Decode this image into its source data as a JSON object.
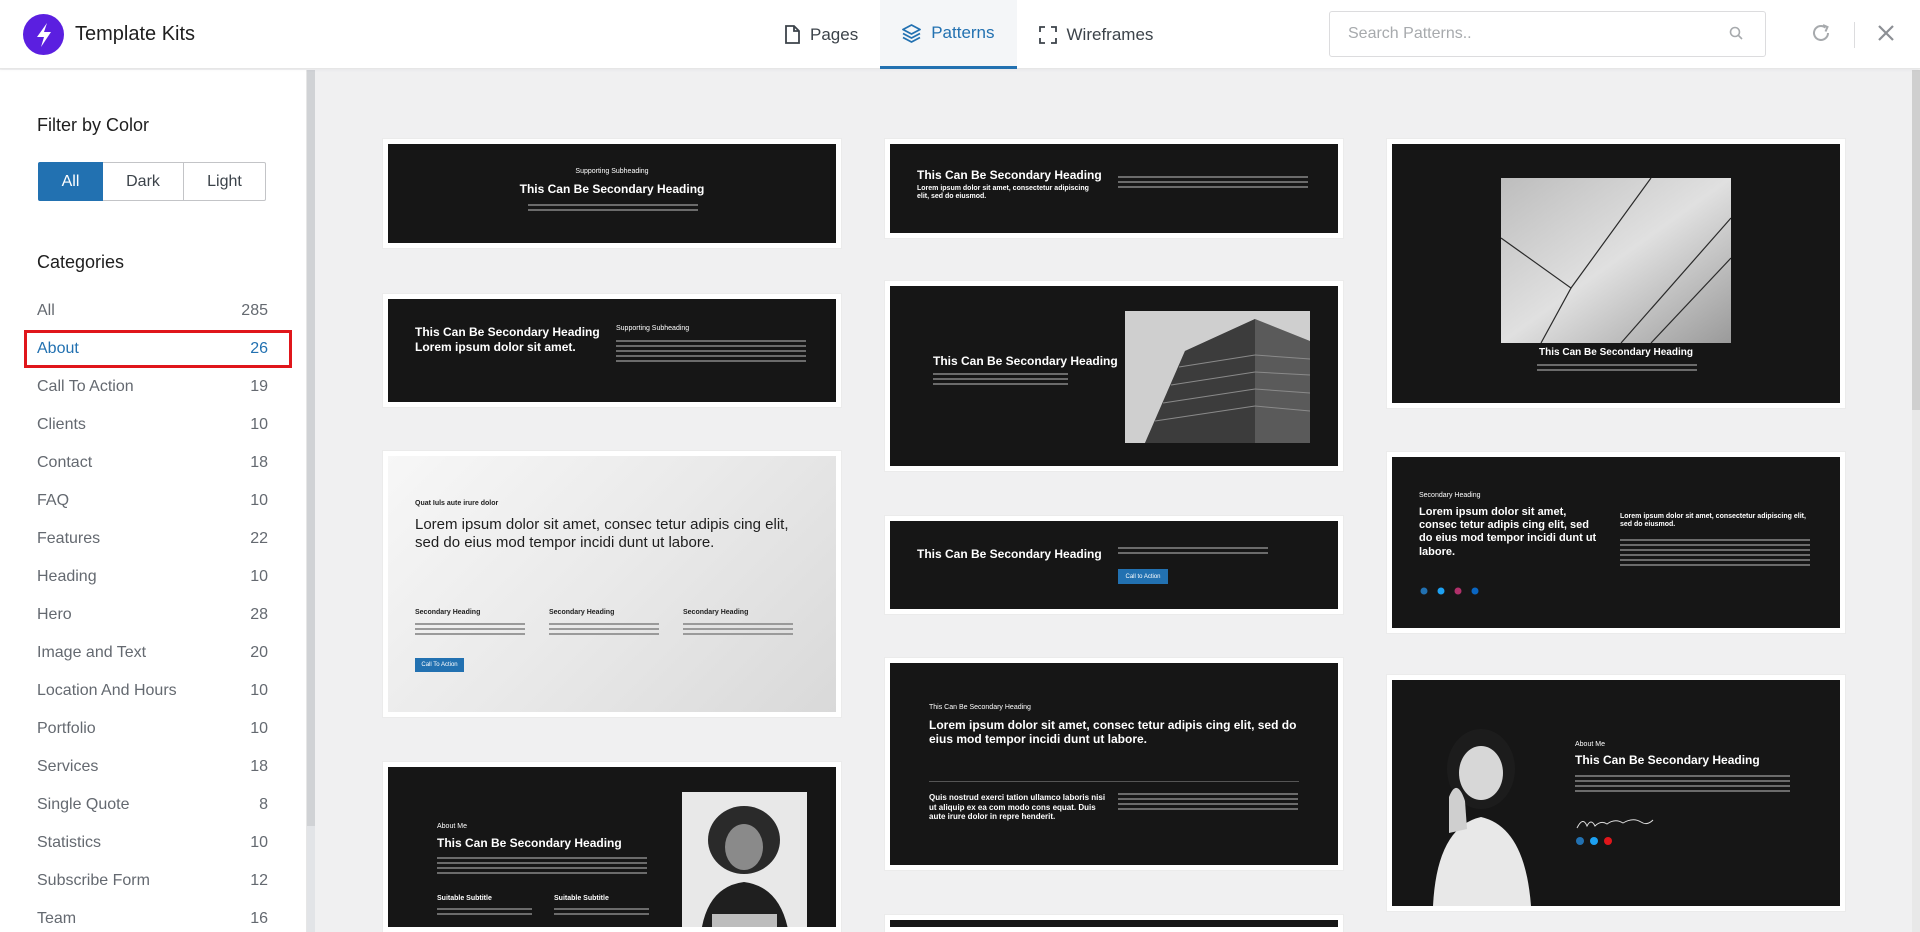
{
  "header": {
    "app_title": "Template Kits",
    "tabs": [
      {
        "label": "Pages",
        "icon": "page-icon",
        "active": false
      },
      {
        "label": "Patterns",
        "icon": "layers-icon",
        "active": true
      },
      {
        "label": "Wireframes",
        "icon": "frame-icon",
        "active": false
      }
    ],
    "search_placeholder": "Search Patterns.."
  },
  "sidebar": {
    "filter_title": "Filter by Color",
    "color_filters": [
      "All",
      "Dark",
      "Light"
    ],
    "selected_color_filter": "All",
    "categories_title": "Categories",
    "categories": [
      {
        "label": "All",
        "count": "285"
      },
      {
        "label": "About",
        "count": "26",
        "active": true
      },
      {
        "label": "Call To Action",
        "count": "19"
      },
      {
        "label": "Clients",
        "count": "10"
      },
      {
        "label": "Contact",
        "count": "18"
      },
      {
        "label": "FAQ",
        "count": "10"
      },
      {
        "label": "Features",
        "count": "22"
      },
      {
        "label": "Heading",
        "count": "10"
      },
      {
        "label": "Hero",
        "count": "28"
      },
      {
        "label": "Image and Text",
        "count": "20"
      },
      {
        "label": "Location And Hours",
        "count": "10"
      },
      {
        "label": "Portfolio",
        "count": "10"
      },
      {
        "label": "Services",
        "count": "18"
      },
      {
        "label": "Single Quote",
        "count": "8"
      },
      {
        "label": "Statistics",
        "count": "10"
      },
      {
        "label": "Subscribe Form",
        "count": "12"
      },
      {
        "label": "Team",
        "count": "16"
      }
    ]
  },
  "patterns": {
    "p1": {
      "sub": "Supporting Subheading",
      "heading": "This Can Be Secondary Heading"
    },
    "p2": {
      "heading": "This Can Be Secondary Heading",
      "sub": "Lorem ipsum dolor sit amet, consectetur adipiscing elit, sed do eiusmod."
    },
    "p3": {
      "heading": "This Can Be Secondary Heading"
    },
    "p4": {
      "heading1": "This Can Be Secondary Heading",
      "heading2": "Lorem ipsum dolor sit amet.",
      "sub": "Supporting Subheading"
    },
    "p5": {
      "heading": "This Can Be Secondary Heading"
    },
    "p6": {
      "sub": "Quat Iuls aute irure dolor",
      "heading": "Lorem ipsum dolor sit amet, consec tetur adipis cing elit, sed do eius mod tempor incidi dunt ut labore.",
      "col1": "Secondary Heading",
      "col2": "Secondary Heading",
      "col3": "Secondary Heading",
      "cta": "Call To Action"
    },
    "p7": {
      "heading": "This Can Be Secondary Heading",
      "cta": "Call to Action"
    },
    "p8": {
      "sub": "Secondary Heading",
      "heading": "Lorem ipsum dolor sit amet, consec tetur adipis cing elit, sed do eius mod tempor incidi dunt ut labore.",
      "right": "Lorem ipsum dolor sit amet, consectetur adipiscing elit, sed do eiusmod."
    },
    "p9": {
      "sub": "This Can Be Secondary Heading",
      "heading": "Lorem ipsum dolor sit amet, consec tetur adipis cing elit, sed do eius mod tempor incidi dunt ut labore.",
      "left": "Quis nostrud exerci tation ullamco laboris nisi ut aliquip ex ea com modo cons equat. Duis aute irure dolor in repre henderit."
    },
    "p10": {
      "sub": "About Me",
      "heading": "This Can Be Secondary Heading"
    },
    "p11": {
      "sub": "About Me",
      "heading": "This Can Be Secondary Heading",
      "col1": "Suitable Subtitle",
      "col2": "Suitable Subtitle"
    }
  }
}
